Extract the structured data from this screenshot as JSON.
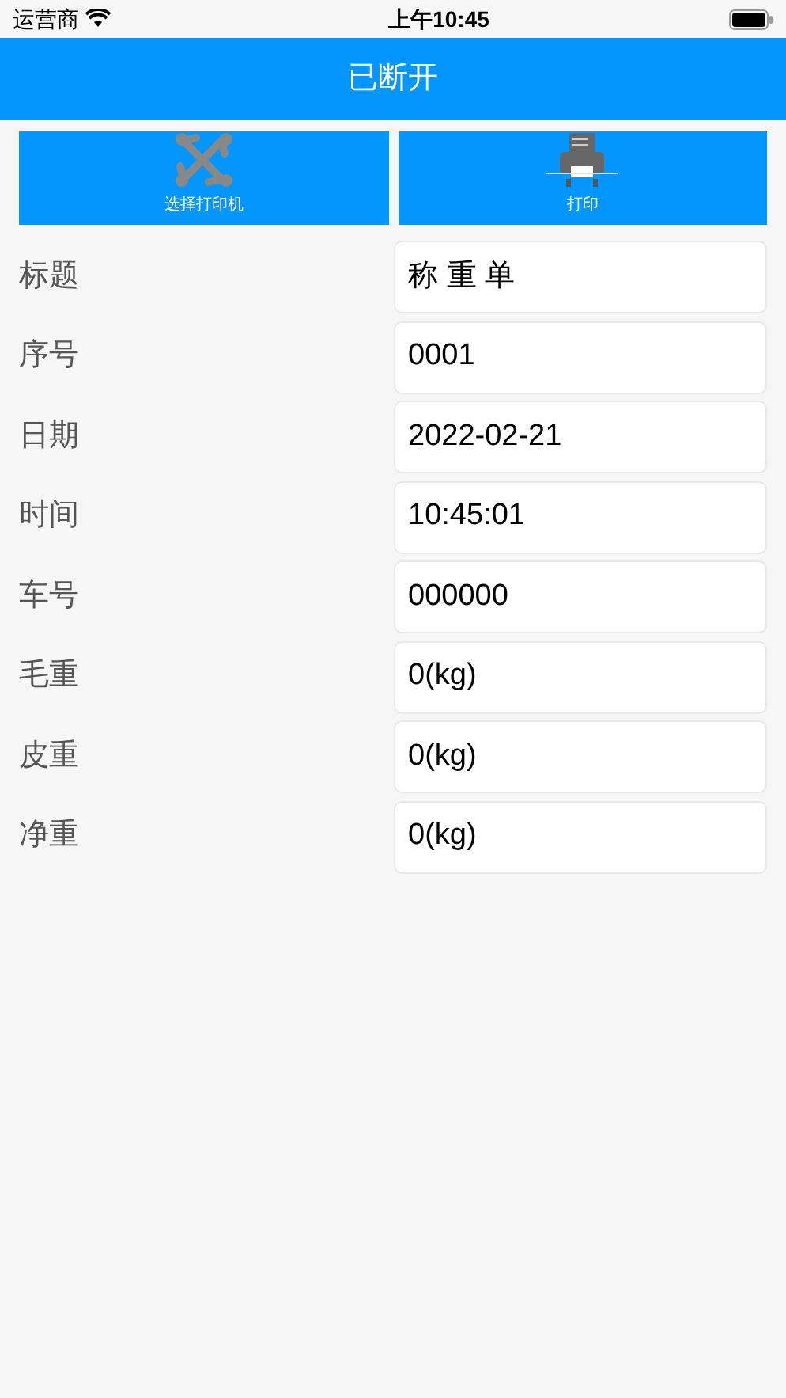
{
  "status_bar": {
    "carrier": "运营商",
    "time": "上午10:45"
  },
  "header": {
    "title": "已断开"
  },
  "actions": [
    {
      "kind": "select_printer",
      "label": "选择打印机"
    },
    {
      "kind": "print",
      "label": "打印"
    }
  ],
  "fields": [
    {
      "label": "标题",
      "value": "称 重 单"
    },
    {
      "label": "序号",
      "value": "0001"
    },
    {
      "label": "日期",
      "value": "2022-02-21"
    },
    {
      "label": "时间",
      "value": "10:45:01"
    },
    {
      "label": "车号",
      "value": "000000"
    },
    {
      "label": "毛重",
      "value": "0(kg)"
    },
    {
      "label": "皮重",
      "value": "0(kg)"
    },
    {
      "label": "净重",
      "value": "0(kg)"
    }
  ]
}
